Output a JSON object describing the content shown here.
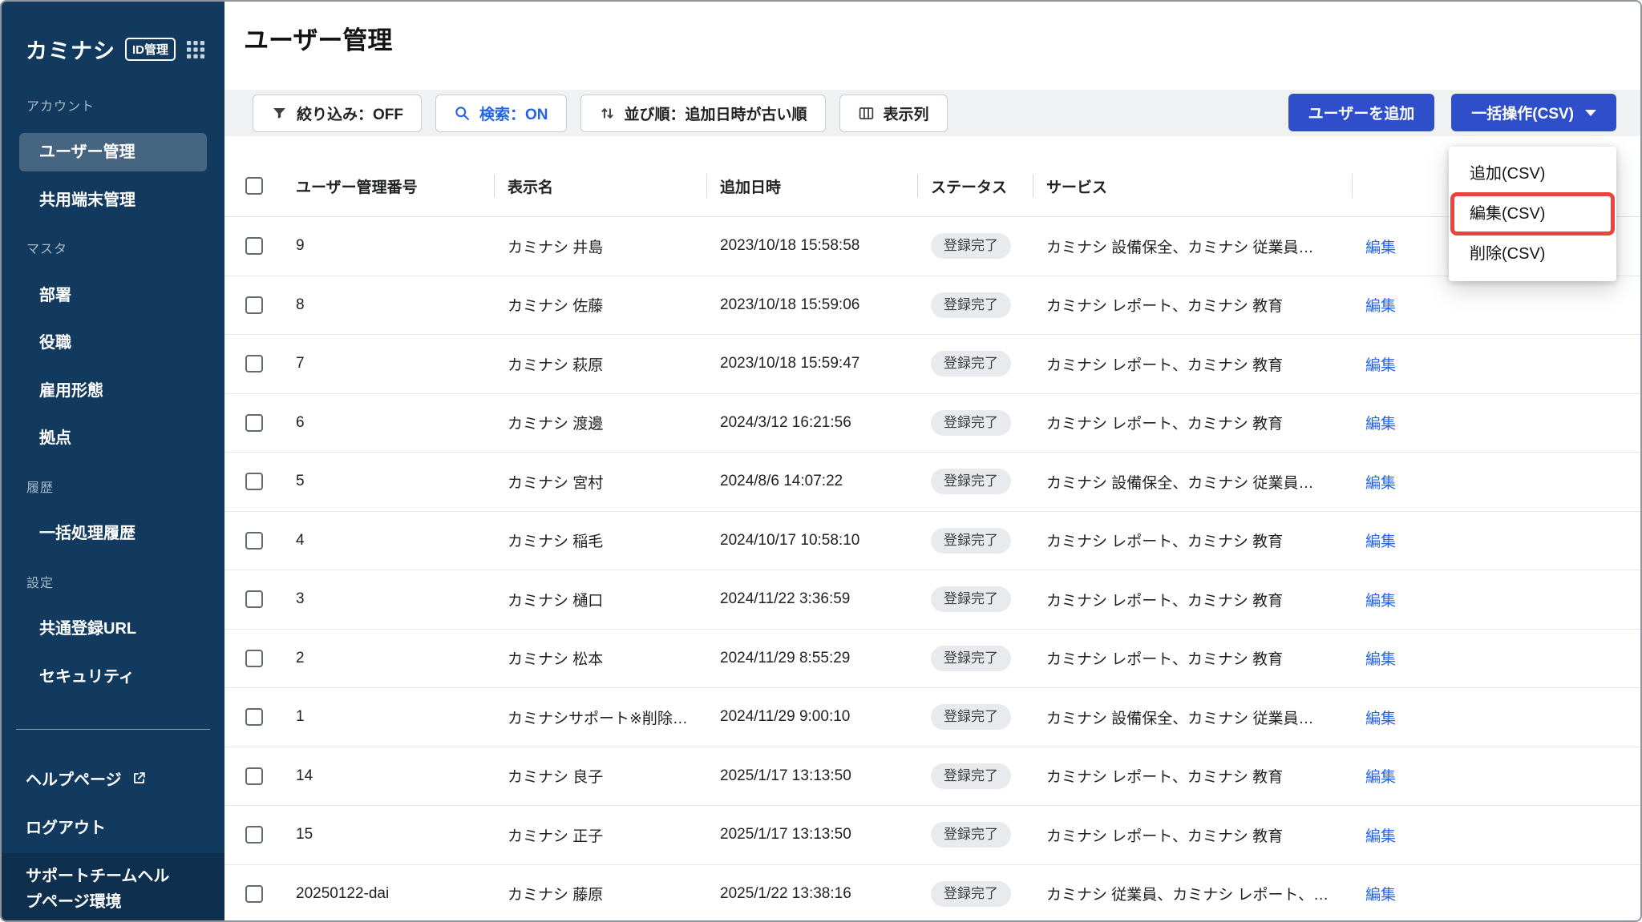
{
  "app": {
    "logo_text": "カミナシ",
    "logo_badge": "ID管理"
  },
  "header": {
    "title": "ユーザー管理"
  },
  "sidebar": {
    "nav": [
      {
        "kind": "section",
        "label": "アカウント"
      },
      {
        "kind": "item",
        "label": "ユーザー管理",
        "active": true
      },
      {
        "kind": "item",
        "label": "共用端末管理"
      },
      {
        "kind": "section",
        "label": "マスタ"
      },
      {
        "kind": "item",
        "label": "部署"
      },
      {
        "kind": "item",
        "label": "役職"
      },
      {
        "kind": "item",
        "label": "雇用形態"
      },
      {
        "kind": "item",
        "label": "拠点"
      },
      {
        "kind": "section",
        "label": "履歴"
      },
      {
        "kind": "item",
        "label": "一括処理履歴"
      },
      {
        "kind": "section",
        "label": "設定"
      },
      {
        "kind": "item",
        "label": "共通登録URL"
      },
      {
        "kind": "item",
        "label": "セキュリティ"
      }
    ],
    "footer": [
      {
        "label": "ヘルプページ",
        "external": true
      },
      {
        "label": "ログアウト"
      }
    ],
    "env_label": "サポートチームヘルプページ環境"
  },
  "toolbar": {
    "filter_label": "絞り込み：OFF",
    "search_label": "検索：ON",
    "sort_label": "並び順：追加日時が古い順",
    "columns_label": "表示列",
    "add_user_label": "ユーザーを追加",
    "bulk_label": "一括操作(CSV)"
  },
  "dropdown": {
    "items": [
      {
        "label": "追加(CSV)"
      },
      {
        "label": "編集(CSV)",
        "highlighted": true
      },
      {
        "label": "削除(CSV)"
      }
    ]
  },
  "table": {
    "headers": [
      "ユーザー管理番号",
      "表示名",
      "追加日時",
      "ステータス",
      "サービス"
    ],
    "edit_label": "編集",
    "rows": [
      {
        "id": "9",
        "name": "カミナシ 井島",
        "date": "2023/10/18 15:58:58",
        "status": "登録完了",
        "services": "カミナシ 設備保全、カミナシ 従業員…"
      },
      {
        "id": "8",
        "name": "カミナシ 佐藤",
        "date": "2023/10/18 15:59:06",
        "status": "登録完了",
        "services": "カミナシ レポート、カミナシ 教育"
      },
      {
        "id": "7",
        "name": "カミナシ 萩原",
        "date": "2023/10/18 15:59:47",
        "status": "登録完了",
        "services": "カミナシ レポート、カミナシ 教育"
      },
      {
        "id": "6",
        "name": "カミナシ 渡邊",
        "date": "2024/3/12 16:21:56",
        "status": "登録完了",
        "services": "カミナシ レポート、カミナシ 教育"
      },
      {
        "id": "5",
        "name": "カミナシ 宮村",
        "date": "2024/8/6 14:07:22",
        "status": "登録完了",
        "services": "カミナシ 設備保全、カミナシ 従業員…"
      },
      {
        "id": "4",
        "name": "カミナシ 稲毛",
        "date": "2024/10/17 10:58:10",
        "status": "登録完了",
        "services": "カミナシ レポート、カミナシ 教育"
      },
      {
        "id": "3",
        "name": "カミナシ 樋口",
        "date": "2024/11/22 3:36:59",
        "status": "登録完了",
        "services": "カミナシ レポート、カミナシ 教育"
      },
      {
        "id": "2",
        "name": "カミナシ 松本",
        "date": "2024/11/29 8:55:29",
        "status": "登録完了",
        "services": "カミナシ レポート、カミナシ 教育"
      },
      {
        "id": "1",
        "name": "カミナシサポート※削除…",
        "date": "2024/11/29 9:00:10",
        "status": "登録完了",
        "services": "カミナシ 設備保全、カミナシ 従業員…"
      },
      {
        "id": "14",
        "name": "カミナシ 良子",
        "date": "2025/1/17 13:13:50",
        "status": "登録完了",
        "services": "カミナシ レポート、カミナシ 教育"
      },
      {
        "id": "15",
        "name": "カミナシ 正子",
        "date": "2025/1/17 13:13:50",
        "status": "登録完了",
        "services": "カミナシ レポート、カミナシ 教育"
      },
      {
        "id": "20250122-dai",
        "name": "カミナシ 藤原",
        "date": "2025/1/22 13:38:16",
        "status": "登録完了",
        "services": "カミナシ 従業員、カミナシ レポート、…"
      }
    ]
  },
  "colors": {
    "sidebar_bg": "#123A5E",
    "primary_button_blue": "#2E4FC9",
    "link_blue": "#2563EB",
    "annotation_red": "#E8453C",
    "badge_bg": "#E8EAED",
    "toolbar_bg": "#EFF1F2"
  }
}
